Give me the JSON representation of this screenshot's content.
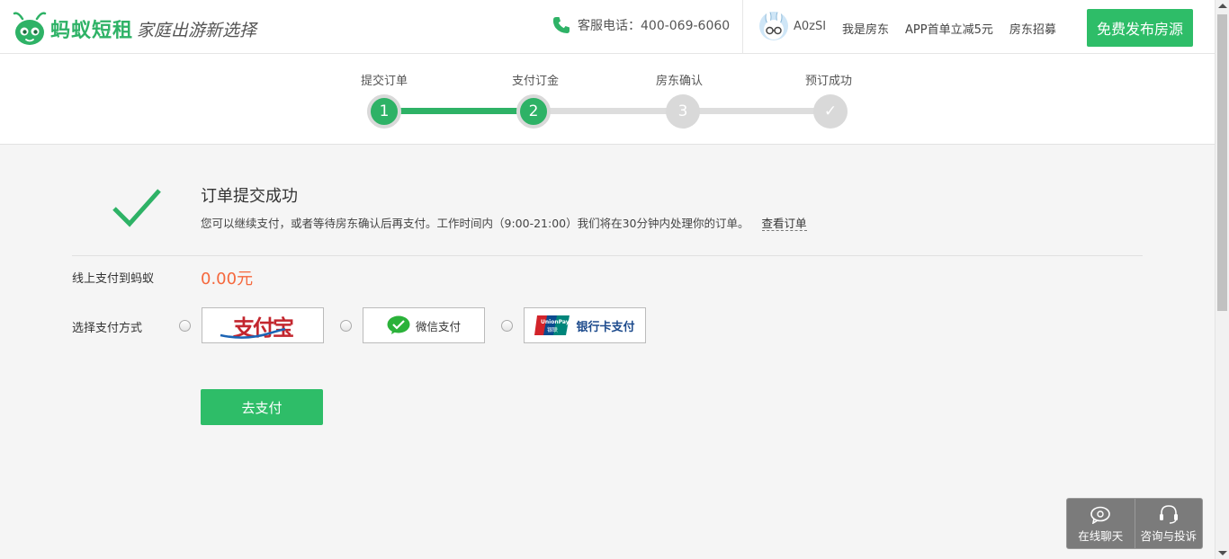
{
  "header": {
    "brand": "蚂蚁短租",
    "slogan": "家庭出游新选择",
    "hotline": "客服电话：400-069-6060",
    "username": "A0zSI",
    "links": [
      "我是房东",
      "APP首单立减5元",
      "房东招募"
    ],
    "publish_label": "免费发布房源"
  },
  "progress": {
    "steps": [
      {
        "label": "提交订单",
        "number": "1",
        "state": "done"
      },
      {
        "label": "支付订金",
        "number": "2",
        "state": "done"
      },
      {
        "label": "房东确认",
        "number": "3",
        "state": "todo"
      },
      {
        "label": "预订成功",
        "number": "✓",
        "state": "todo"
      }
    ]
  },
  "result": {
    "title": "订单提交成功",
    "description": "您可以继续支付，或者等待房东确认后再支付。工作时间内（9:00-21:00）我们将在30分钟内处理你的订单。",
    "view_order_label": "查看订单"
  },
  "payment": {
    "amount_label": "线上支付到蚂蚁",
    "amount": "0.00元",
    "method_label": "选择支付方式",
    "methods": [
      {
        "name": "支付宝",
        "icon": "alipay-logo"
      },
      {
        "name": "微信支付",
        "icon": "wechat-logo"
      },
      {
        "name": "银行卡支付",
        "icon": "unionpay-logo"
      }
    ],
    "submit_label": "去支付"
  },
  "float_service": {
    "chat_label": "在线聊天",
    "complaint_label": "咨询与投诉"
  },
  "colors": {
    "accent": "#2ebd68",
    "amount": "#f5683d"
  }
}
